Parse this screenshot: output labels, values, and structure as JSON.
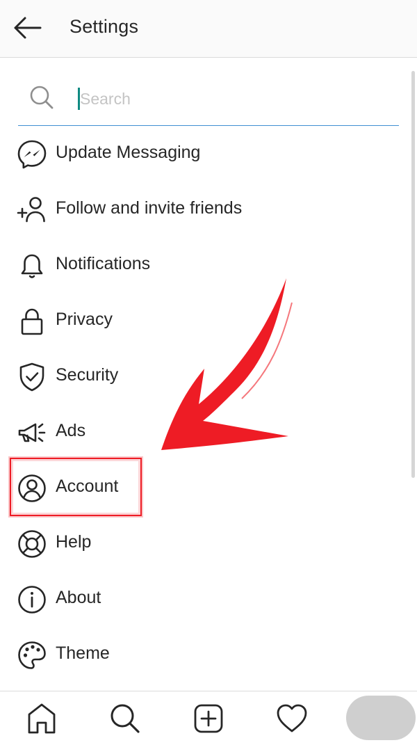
{
  "header": {
    "title": "Settings",
    "back_icon": "arrow-left-icon"
  },
  "search": {
    "placeholder": "Search",
    "value": "",
    "icon": "search-icon",
    "underline_color": "#3f8fd2"
  },
  "menu": {
    "items": [
      {
        "label": "Update Messaging",
        "icon": "messenger-icon"
      },
      {
        "label": "Follow and invite friends",
        "icon": "add-person-icon"
      },
      {
        "label": "Notifications",
        "icon": "bell-icon"
      },
      {
        "label": "Privacy",
        "icon": "lock-icon"
      },
      {
        "label": "Security",
        "icon": "shield-check-icon"
      },
      {
        "label": "Ads",
        "icon": "megaphone-icon"
      },
      {
        "label": "Account",
        "icon": "account-circle-icon",
        "highlighted": true
      },
      {
        "label": "Help",
        "icon": "lifebuoy-icon"
      },
      {
        "label": "About",
        "icon": "info-icon"
      },
      {
        "label": "Theme",
        "icon": "palette-icon"
      }
    ]
  },
  "annotation": {
    "color": "#ee1c25",
    "arrow_icon": "red-arrow-icon"
  },
  "bottom_nav": {
    "items": [
      {
        "icon": "home-icon"
      },
      {
        "icon": "search-icon"
      },
      {
        "icon": "new-post-icon"
      },
      {
        "icon": "heart-icon"
      },
      {
        "icon": "profile-avatar"
      }
    ]
  }
}
